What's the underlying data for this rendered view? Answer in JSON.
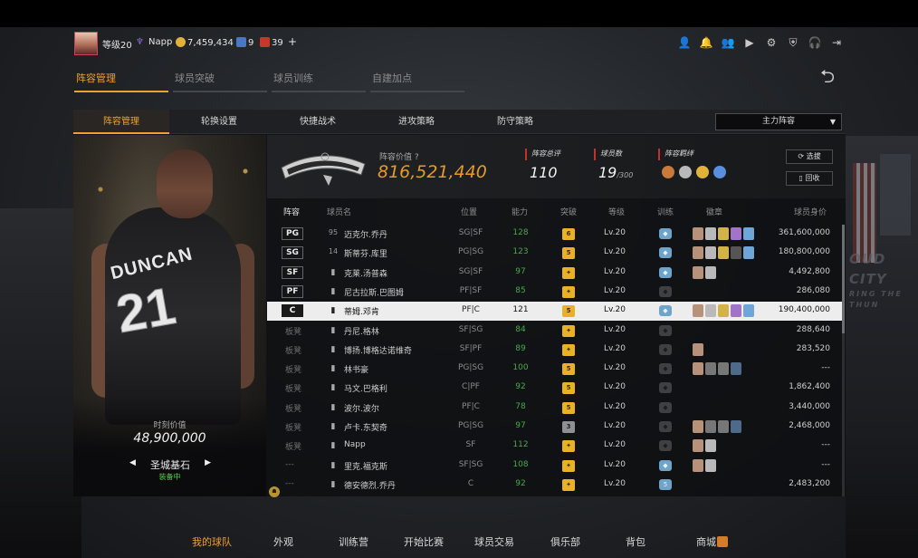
{
  "header": {
    "level": "等级20",
    "username": "Napp",
    "coins": "7,459,434",
    "stars": "9",
    "tokens": "39",
    "plus": "+"
  },
  "main_tabs": [
    {
      "label": "阵容管理"
    },
    {
      "label": "球员突破"
    },
    {
      "label": "球员训练"
    },
    {
      "label": "自建加点"
    }
  ],
  "sub_tabs": [
    {
      "label": "阵容管理"
    },
    {
      "label": "轮换设置"
    },
    {
      "label": "快捷战术"
    },
    {
      "label": "进攻策略"
    },
    {
      "label": "防守策略"
    }
  ],
  "lineup_select": {
    "value": "主力阵容"
  },
  "player_card": {
    "jersey_name": "DUNCAN",
    "jersey_number": "21",
    "value_label": "时刻价值",
    "value": "48,900,000",
    "name": "圣城基石",
    "status": "装备中"
  },
  "team": {
    "value_label": "阵容价值",
    "value": "816,521,440",
    "rating_label": "阵容总评",
    "rating": "110",
    "count_label": "球员数",
    "count": "19",
    "count_max": "/300",
    "bond_label": "阵容羁绊",
    "select_btn": "选拔",
    "recycle_btn": "回收"
  },
  "table": {
    "headers": [
      "阵容",
      "球员名",
      "位置",
      "能力",
      "突破",
      "等级",
      "训练",
      "徽章",
      "球员身价"
    ],
    "rows": [
      {
        "slot": "PG",
        "starter": true,
        "num": "95",
        "name": "迈克尔.乔丹",
        "pos": "SG|SF",
        "rating": "128",
        "brk": "6",
        "lv": "Lv.20",
        "train": "on",
        "badges": [
          "#b8917a",
          "#b9b9b9",
          "#d4b24a",
          "#a274c9",
          "#6ea6d8"
        ],
        "salary": "361,600,000"
      },
      {
        "slot": "SG",
        "starter": true,
        "num": "14",
        "name": "斯蒂芬.库里",
        "pos": "PG|SG",
        "rating": "123",
        "brk": "5",
        "lv": "Lv.20",
        "train": "on",
        "badges": [
          "#b8917a",
          "#b9b9b9",
          "#d4b24a",
          "#555",
          "#6ea6d8"
        ],
        "salary": "180,800,000"
      },
      {
        "slot": "SF",
        "starter": true,
        "num": "",
        "name": "克莱.汤普森",
        "pos": "SG|SF",
        "rating": "97",
        "brk": "",
        "lv": "Lv.20",
        "train": "on",
        "badges": [
          "#b8917a",
          "#b9b9b9"
        ],
        "salary": "4,492,800"
      },
      {
        "slot": "PF",
        "starter": true,
        "num": "",
        "name": "尼古拉斯.巴图姆",
        "pos": "PF|SF",
        "rating": "85",
        "brk": "",
        "lv": "Lv.20",
        "train": "off",
        "badges": [],
        "salary": "286,080"
      },
      {
        "slot": "C",
        "starter": true,
        "num": "",
        "name": "蒂姆.邓肯",
        "pos": "PF|C",
        "rating": "121",
        "brk": "5",
        "lv": "Lv.20",
        "train": "on",
        "badges": [
          "#b8917a",
          "#b9b9b9",
          "#d4b24a",
          "#a274c9",
          "#6ea6d8"
        ],
        "salary": "190,400,000"
      },
      {
        "slot": "板凳",
        "starter": false,
        "num": "",
        "name": "丹尼.格林",
        "pos": "SF|SG",
        "rating": "84",
        "brk": "",
        "lv": "Lv.20",
        "train": "off",
        "badges": [],
        "salary": "288,640"
      },
      {
        "slot": "板凳",
        "starter": false,
        "num": "",
        "name": "博扬.博格达诺维奇",
        "pos": "SF|PF",
        "rating": "89",
        "brk": "",
        "lv": "Lv.20",
        "train": "off",
        "badges": [
          "#b8917a"
        ],
        "salary": "283,520"
      },
      {
        "slot": "板凳",
        "starter": false,
        "num": "",
        "name": "林书豪",
        "pos": "PG|SG",
        "rating": "100",
        "brk": "5",
        "lv": "Lv.20",
        "train": "off",
        "badges": [
          "#b8917a",
          "#777",
          "#777",
          "#4d6a88"
        ],
        "salary": "---"
      },
      {
        "slot": "板凳",
        "starter": false,
        "num": "",
        "name": "马文.巴格利",
        "pos": "C|PF",
        "rating": "92",
        "brk": "5",
        "lv": "Lv.20",
        "train": "off",
        "badges": [],
        "salary": "1,862,400"
      },
      {
        "slot": "板凳",
        "starter": false,
        "num": "",
        "name": "波尔.波尔",
        "pos": "PF|C",
        "rating": "78",
        "brk": "5",
        "lv": "Lv.20",
        "train": "off",
        "badges": [],
        "salary": "3,440,000"
      },
      {
        "slot": "板凳",
        "starter": false,
        "num": "",
        "name": "卢卡.东契奇",
        "pos": "PG|SG",
        "rating": "97",
        "brk": "3",
        "lv": "Lv.20",
        "train": "off",
        "badges": [
          "#b8917a",
          "#777",
          "#777",
          "#4d6a88"
        ],
        "salary": "2,468,000"
      },
      {
        "slot": "板凳",
        "starter": false,
        "num": "",
        "name": "Napp",
        "pos": "SF",
        "rating": "112",
        "brk": "",
        "lv": "Lv.20",
        "train": "off",
        "badges": [
          "#b8917a",
          "#b9b9b9"
        ],
        "salary": "---"
      },
      {
        "slot": "---",
        "starter": false,
        "num": "",
        "name": "里克.福克斯",
        "pos": "SF|SG",
        "rating": "108",
        "brk": "",
        "lv": "Lv.20",
        "train": "on",
        "badges": [
          "#b8917a",
          "#b9b9b9"
        ],
        "salary": "---"
      },
      {
        "slot": "---",
        "starter": false,
        "num": "",
        "name": "德安德烈.乔丹",
        "pos": "C",
        "rating": "92",
        "brk": "",
        "lv": "Lv.20",
        "train": "on5",
        "badges": [],
        "salary": "2,483,200"
      }
    ]
  },
  "bottom_nav": [
    {
      "label": "我的球队"
    },
    {
      "label": "外观"
    },
    {
      "label": "训练营"
    },
    {
      "label": "开始比赛"
    },
    {
      "label": "球员交易"
    },
    {
      "label": "俱乐部"
    },
    {
      "label": "背包"
    },
    {
      "label": "商城"
    }
  ],
  "background_sign": {
    "line1": "OUD CITY",
    "line2": "RING THE THUN"
  },
  "colors": {
    "accent": "#f0a12b",
    "rating_green": "#49a94b",
    "badge_gold": "#e8b224"
  }
}
